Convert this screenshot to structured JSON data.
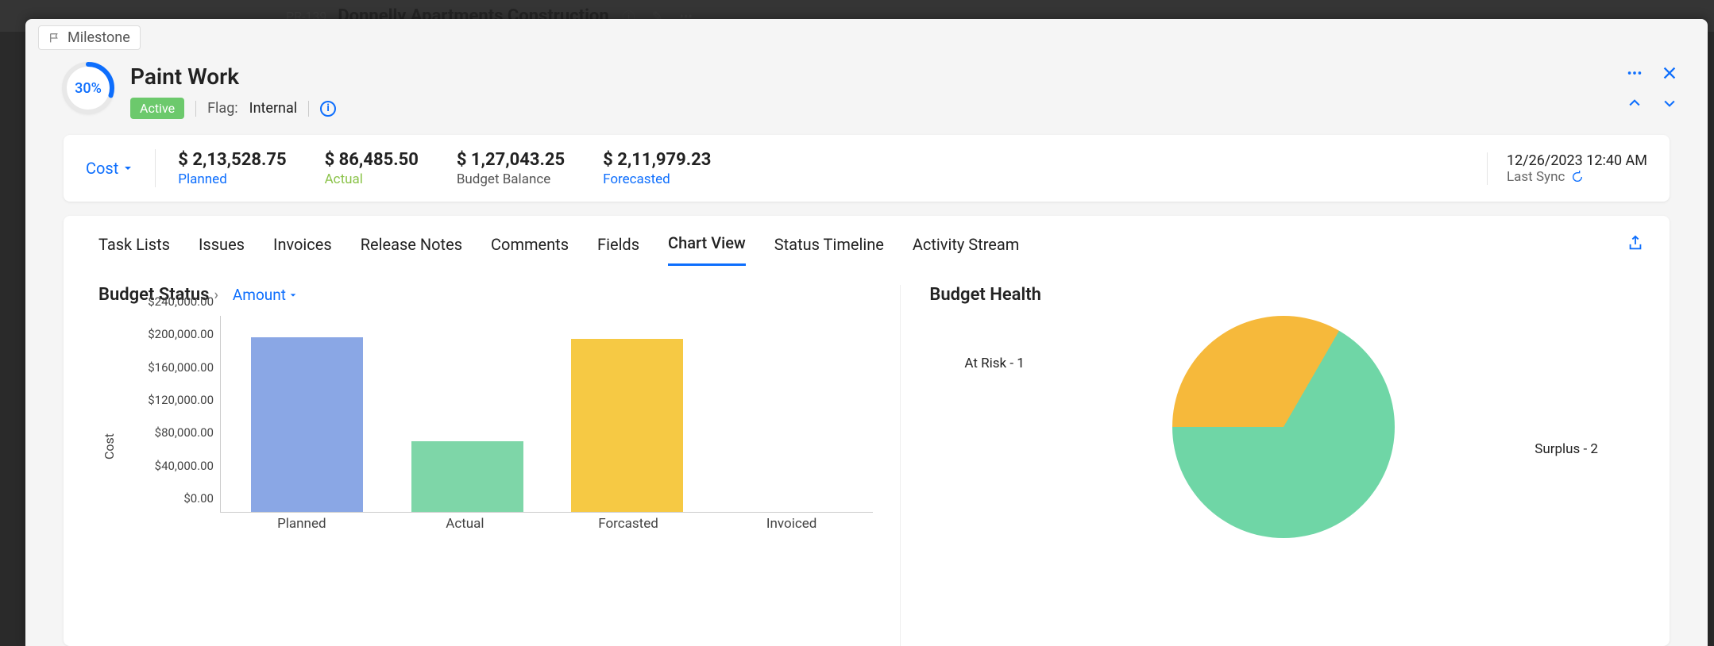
{
  "background": {
    "pr_code": "PR-139",
    "pr_title": "Donnelly Apartments Construction"
  },
  "milestone_tag": "Milestone",
  "header": {
    "progress_pct": "30%",
    "progress_value": 30,
    "title": "Paint Work",
    "status_badge": "Active",
    "flag_label": "Flag:",
    "flag_value": "Internal"
  },
  "cost_bar": {
    "dropdown_label": "Cost",
    "items": [
      {
        "value": "$ 2,13,528.75",
        "label": "Planned",
        "class": "planned"
      },
      {
        "value": "$ 86,485.50",
        "label": "Actual",
        "class": "actual"
      },
      {
        "value": "$ 1,27,043.25",
        "label": "Budget Balance",
        "class": "balance"
      },
      {
        "value": "$ 2,11,979.23",
        "label": "Forecasted",
        "class": "forecasted"
      }
    ],
    "sync_time": "12/26/2023 12:40 AM",
    "sync_label": "Last Sync"
  },
  "tabs": [
    "Task Lists",
    "Issues",
    "Invoices",
    "Release Notes",
    "Comments",
    "Fields",
    "Chart View",
    "Status Timeline",
    "Activity Stream"
  ],
  "active_tab": "Chart View",
  "budget_status": {
    "title": "Budget Status",
    "dropdown": "Amount"
  },
  "budget_health": {
    "title": "Budget Health"
  },
  "chart_data": [
    {
      "type": "bar",
      "title": "Budget Status",
      "ylabel": "Cost",
      "xlabel": "",
      "categories": [
        "Planned",
        "Actual",
        "Forcasted",
        "Invoiced"
      ],
      "values": [
        213528.75,
        86485.5,
        211979.23,
        0
      ],
      "colors": [
        "#8aa7e5",
        "#7ed6a8",
        "#f6c944",
        "#cccccc"
      ],
      "ylim": [
        0,
        240000
      ],
      "y_ticks": [
        "$0.00",
        "$40,000.00",
        "$80,000.00",
        "$120,000.00",
        "$160,000.00",
        "$200,000.00",
        "$240,000.00"
      ]
    },
    {
      "type": "pie",
      "title": "Budget Health",
      "series": [
        {
          "name": "At Risk",
          "value": 1,
          "label": "At Risk - 1",
          "color": "#f6b93b"
        },
        {
          "name": "Surplus",
          "value": 2,
          "label": "Surplus - 2",
          "color": "#6fd6a6"
        }
      ]
    }
  ]
}
